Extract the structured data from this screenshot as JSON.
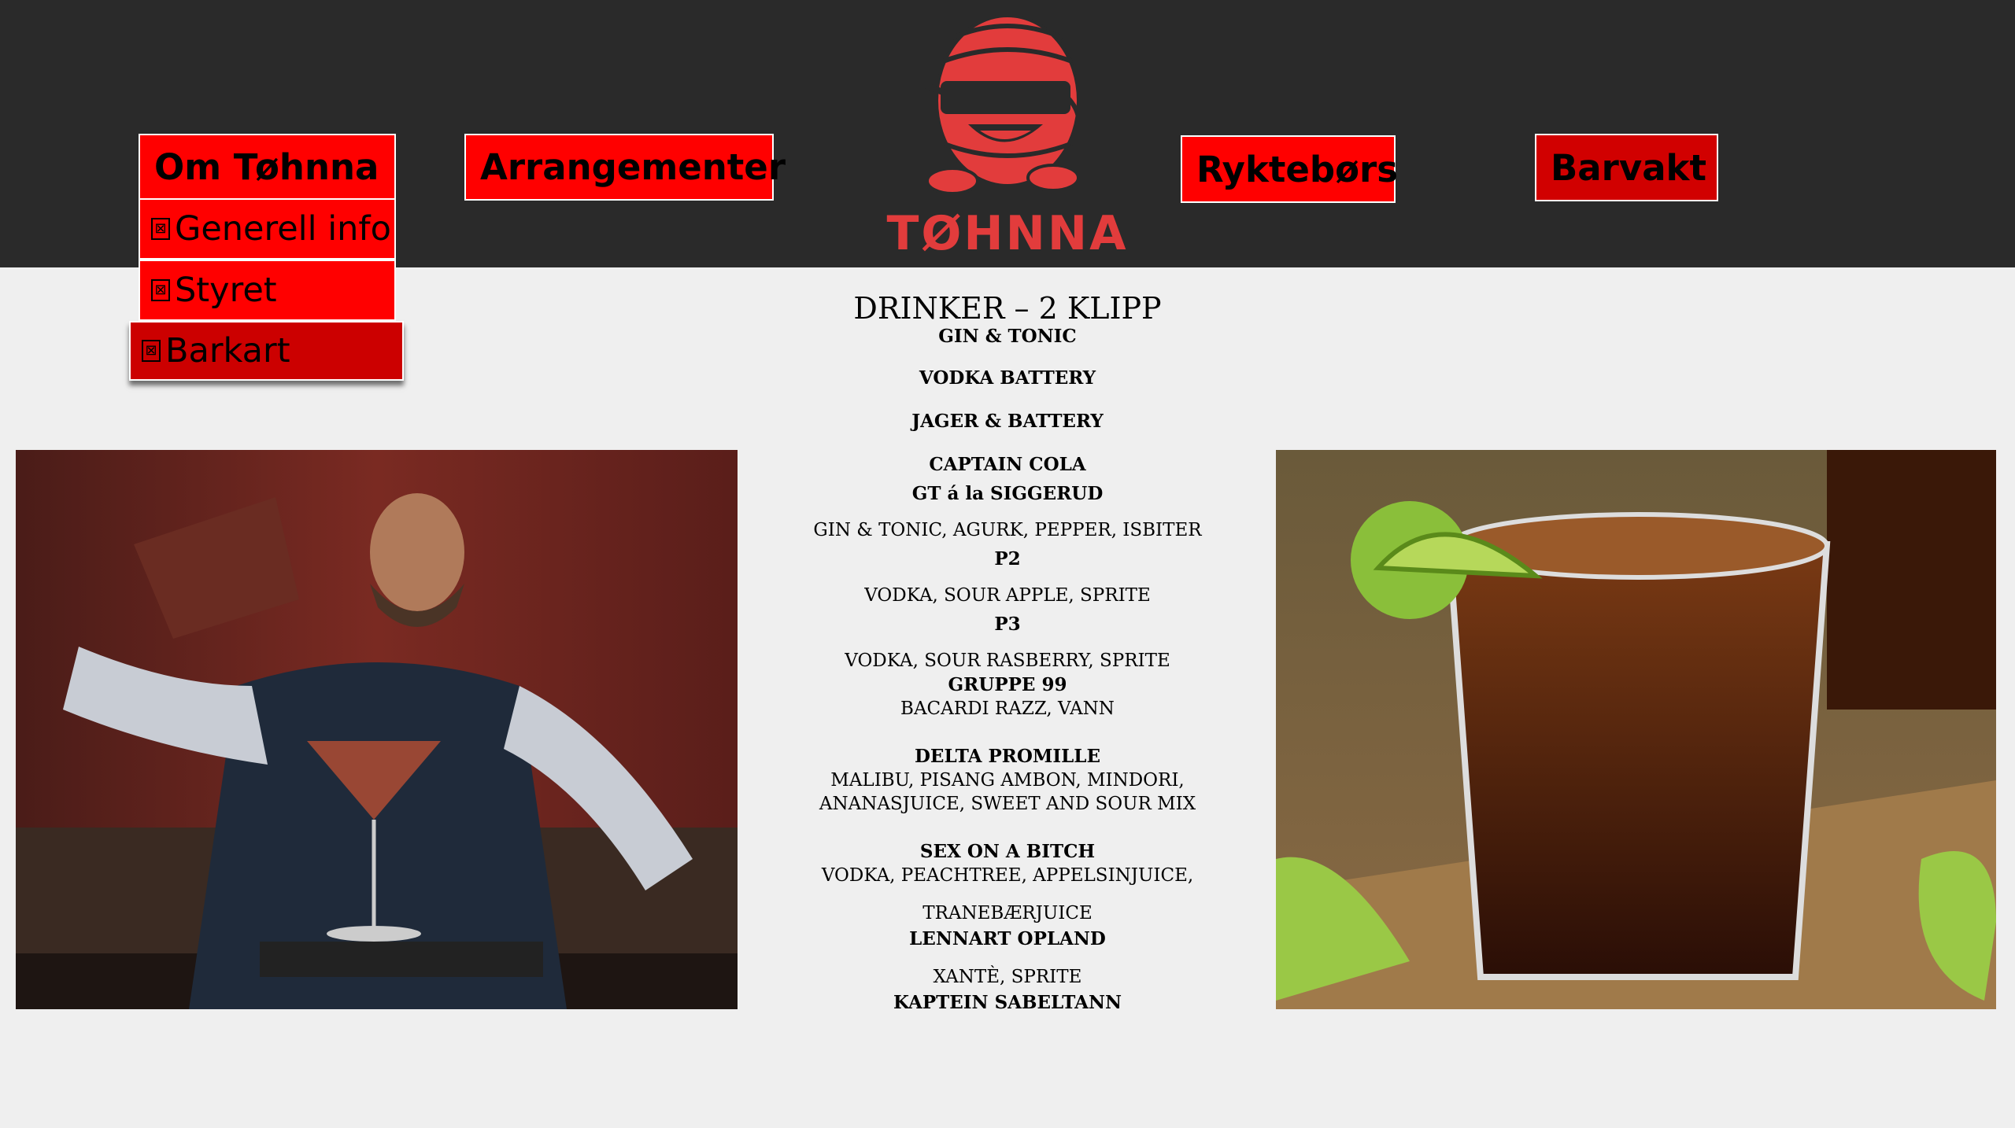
{
  "nav": {
    "om_tohnna": "Om Tøhnna",
    "arrangementer": "Arrangementer",
    "ryktebors": "Ryktebørs",
    "barvakt": "Barvakt",
    "submenu": [
      "Generell info",
      "Styret",
      "Barkart"
    ],
    "active_sub": "Barkart"
  },
  "logo": {
    "text": "TØHNNA"
  },
  "menu": {
    "title": "DRINKER – 2 KLIPP",
    "lines": {
      "l1": "GIN & TONIC",
      "l2": "VODKA BATTERY",
      "l3": "JAGER & BATTERY",
      "l4": "CAPTAIN COLA",
      "l5": "GT á la SIGGERUD",
      "l6": "GIN & TONIC, AGURK, PEPPER, ISBITER",
      "l7": "P2",
      "l8": "VODKA, SOUR APPLE, SPRITE",
      "l9": "P3",
      "l10": "VODKA, SOUR RASBERRY, SPRITE",
      "l11": "GRUPPE 99",
      "l12": "BACARDI RAZZ, VANN",
      "l13": "DELTA PROMILLE",
      "l14": "MALIBU, PISANG AMBON, MINDORI,",
      "l15": "ANANASJUICE, SWEET AND SOUR MIX",
      "l16": "SEX ON A BITCH",
      "l17": "VODKA, PEACHTREE, APPELSINJUICE,",
      "l18": "TRANEBÆRJUICE",
      "l19": "LENNART OPLAND",
      "l20": "XANTÈ, SPRITE",
      "l21": "KAPTEIN SABELTANN"
    }
  },
  "colors": {
    "header_bg": "#2a2a2a",
    "button_red": "#ff0000",
    "button_dark_red": "#d10000",
    "logo_red": "#e23c3c",
    "page_bg": "#efefef"
  }
}
